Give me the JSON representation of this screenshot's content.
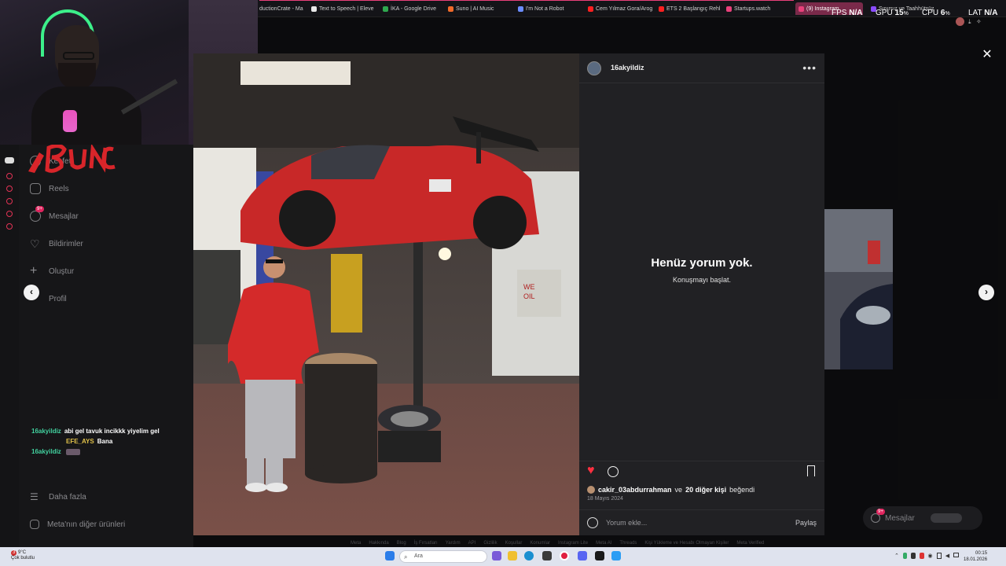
{
  "browser": {
    "tabs": [
      {
        "label": "ductionCrate - Mak",
        "color": "#3a3a3a"
      },
      {
        "label": "Text to Speech | Eleve",
        "color": "#e8e8e8"
      },
      {
        "label": "İKA - Google Drive",
        "color": "#2fa84f"
      },
      {
        "label": "Suno | AI Music",
        "color": "#f06a2a"
      },
      {
        "label": "I'm Not a Robot",
        "color": "#6b8cff"
      },
      {
        "label": "Cem Yılmaz Gora/Arog",
        "color": "#ff2020"
      },
      {
        "label": "ETS 2 Başlangıç Rehbe",
        "color": "#ff2020"
      },
      {
        "label": "Startups.watch",
        "color": "#e8407a"
      },
      {
        "label": "(9) Instagram",
        "color": "#e8407a",
        "active": true
      },
      {
        "label": "Sınırsız ve Taahhütsüz",
        "color": "#8a4cff"
      }
    ]
  },
  "perf": {
    "fps_label": "FPS",
    "fps_value": "N/A",
    "gpu_label": "GPU",
    "gpu_value": "15",
    "cpu_label": "CPU",
    "cpu_value": "6",
    "lat_label": "LAT",
    "lat_value": "N/A",
    "percent": "%"
  },
  "sidebar": {
    "items": [
      {
        "label": "Keşfet",
        "icon": "compass-icon"
      },
      {
        "label": "Reels",
        "icon": "reels-icon"
      },
      {
        "label": "Mesajlar",
        "icon": "messenger-icon",
        "badge": "9+"
      },
      {
        "label": "Bildirimler",
        "icon": "heart-icon"
      },
      {
        "label": "Oluştur",
        "icon": "plus-icon"
      },
      {
        "label": "Profil",
        "icon": "profile-icon"
      }
    ],
    "more": "Daha fazla",
    "meta": "Meta'nın diğer ürünleri"
  },
  "chat": [
    {
      "user": "16akyildiz",
      "message": "abi gel tavuk incikkk yiyelim gel",
      "color": "#42d3a0"
    },
    {
      "user": "EFE_AYS",
      "message": "Bana",
      "color": "#e0c14a"
    },
    {
      "user": "16akyildiz",
      "message": "",
      "color": "#42d3a0"
    }
  ],
  "post": {
    "username": "16akyildiz",
    "empty_title": "Henüz yorum yok.",
    "empty_sub": "Konuşmayı başlat.",
    "liker": "cakir_03abdurrahman",
    "and": "ve",
    "others": "20 diğer kişi",
    "liked": "beğendi",
    "date": "18 Mayıs 2024",
    "comment_placeholder": "Yorum ekle...",
    "share": "Paylaş",
    "more_dots": "•••"
  },
  "floating": {
    "messages": "Mesajlar",
    "badge": "9+"
  },
  "footer": {
    "links": [
      "Meta",
      "Hakkında",
      "Blog",
      "İş Fırsatları",
      "Yardım",
      "API",
      "Gizlilik",
      "Koşullar",
      "Konumlar",
      "Instagram Lite",
      "Meta AI",
      "Threads",
      "Kişi Yükleme ve Hesabı Olmayan Kişiler",
      "Meta Verified"
    ]
  },
  "taskbar": {
    "weather_temp": "9°C",
    "weather_desc": "Çok bulutlu",
    "weather_badge": "3",
    "search_placeholder": "Ara",
    "time": "00:15",
    "date": "18.01.2026"
  }
}
